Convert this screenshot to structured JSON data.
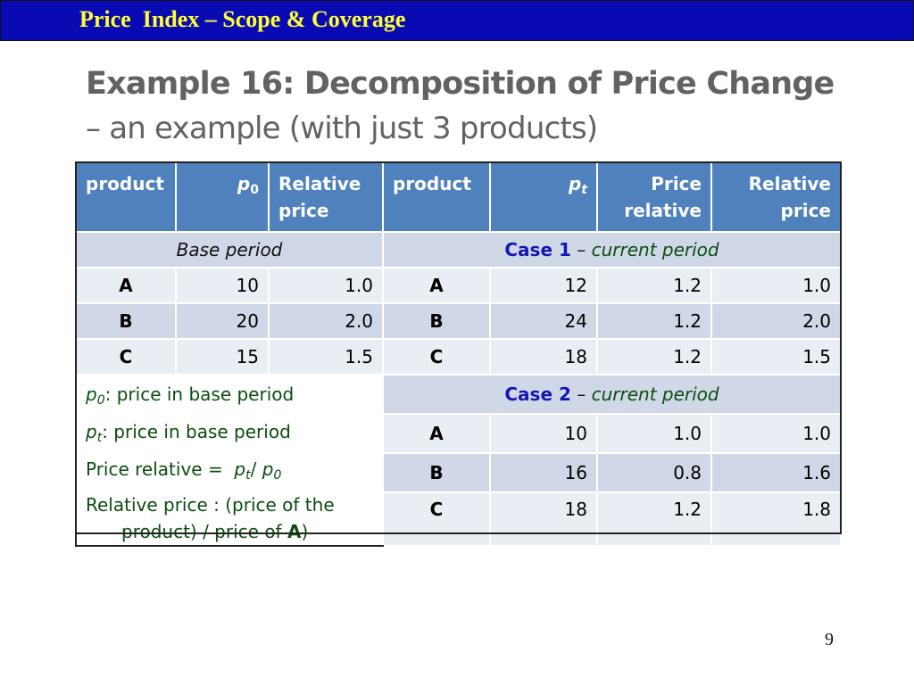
{
  "header": {
    "title": "Price  Index – Scope & Coverage"
  },
  "slide": {
    "title_line1": "Example 16: Decomposition of Price Change",
    "title_line2": "– an example (with just 3 products)",
    "page_number": "9"
  },
  "table": {
    "headers": {
      "product": "product",
      "p0": "p",
      "p0_sub": "0",
      "relative_price_1": "Relative",
      "relative_price_2": "price",
      "product2": "product",
      "pt": "p",
      "pt_sub": "t",
      "price_relative_1": "Price",
      "price_relative_2": "relative",
      "relative_price_right_1": "Relative",
      "relative_price_right_2": "price"
    },
    "base_period_label": "Base period",
    "case1": {
      "label": "Case 1",
      "dash": " – ",
      "period": "current period"
    },
    "case2": {
      "label": "Case 2",
      "dash": " – ",
      "period": "current period"
    },
    "base_rows": [
      {
        "product": "A",
        "p0": "10",
        "relative_price": "1.0"
      },
      {
        "product": "B",
        "p0": "20",
        "relative_price": "2.0"
      },
      {
        "product": "C",
        "p0": "15",
        "relative_price": "1.5"
      }
    ],
    "case1_rows": [
      {
        "product": "A",
        "pt": "12",
        "price_relative": "1.2",
        "relative_price": "1.0"
      },
      {
        "product": "B",
        "pt": "24",
        "price_relative": "1.2",
        "relative_price": "2.0"
      },
      {
        "product": "C",
        "pt": "18",
        "price_relative": "1.2",
        "relative_price": "1.5"
      }
    ],
    "case2_rows": [
      {
        "product": "A",
        "pt": "10",
        "price_relative": "1.0",
        "relative_price": "1.0"
      },
      {
        "product": "B",
        "pt": "16",
        "price_relative": "0.8",
        "relative_price": "1.6"
      },
      {
        "product": "C",
        "pt": "18",
        "price_relative": "1.2",
        "relative_price": "1.8"
      }
    ],
    "notes": {
      "line1_var": "p",
      "line1_sub": "0",
      "line1_text": ": price in base period",
      "line2_var": "p",
      "line2_sub": "t",
      "line2_text": ": price in base period",
      "line3_text": "Price relative =  ",
      "line3_var1": "p",
      "line3_sub1": "t",
      "line3_slash": "/ ",
      "line3_var2": "p",
      "line3_sub2": "0",
      "line4_text": "Relative price : (price of the",
      "line5_text": "product) / price of ",
      "line5_bold": "A",
      "line5_end": ")"
    }
  }
}
